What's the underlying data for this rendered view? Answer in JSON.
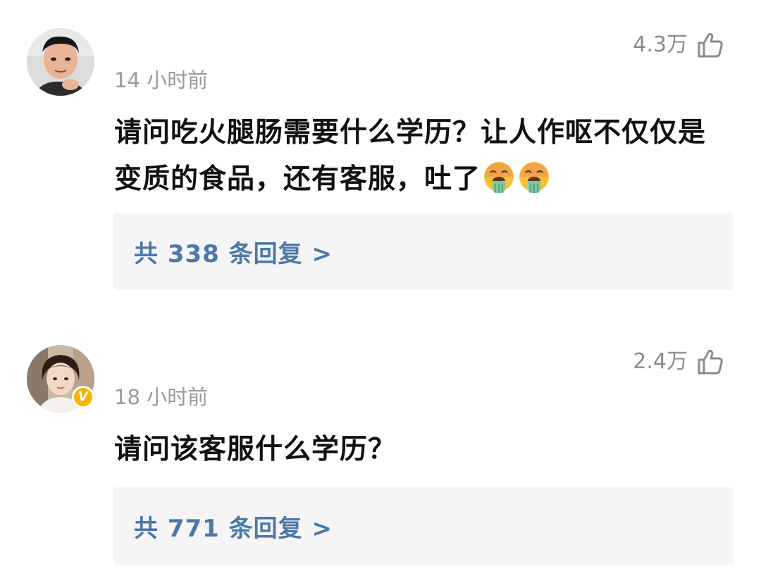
{
  "comments": [
    {
      "time": "14 小时前",
      "likes": "4.3万",
      "text": "请问吃火腿肠需要什么学历？让人作呕不仅仅是变质的食品，还有客服，吐了",
      "emoji_count": 2,
      "emoji": "vomiting-face",
      "replies": "共 338 条回复 >",
      "verified": false
    },
    {
      "time": "18 小时前",
      "likes": "2.4万",
      "text": "请问该客服什么学历？",
      "replies": "共 771 条回复 >",
      "verified": true,
      "verified_badge": "V"
    }
  ],
  "colors": {
    "reply_link": "#4c78a8",
    "reply_box_bg": "#f5f5f7",
    "meta_text": "#9a9a9a",
    "verified_badge": "#f5b400"
  }
}
